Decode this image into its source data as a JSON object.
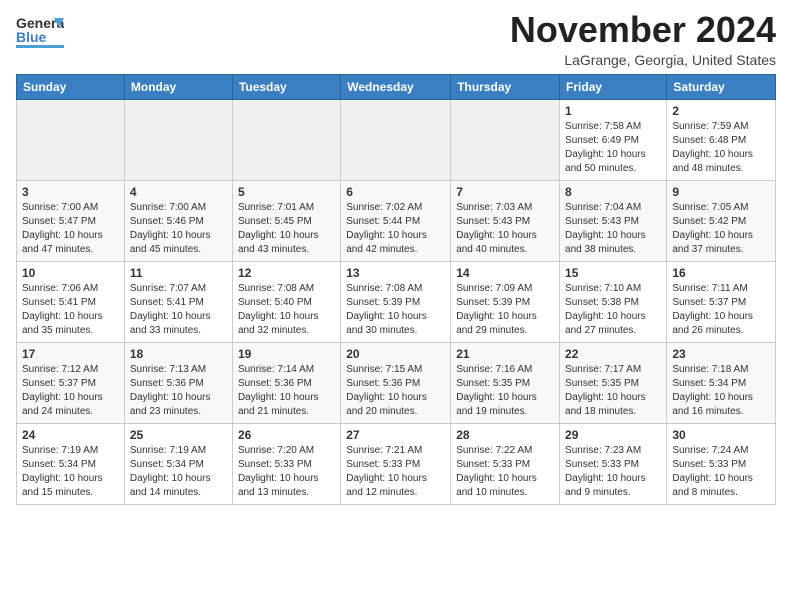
{
  "header": {
    "logo_line1": "General",
    "logo_line2": "Blue",
    "month": "November 2024",
    "location": "LaGrange, Georgia, United States"
  },
  "weekdays": [
    "Sunday",
    "Monday",
    "Tuesday",
    "Wednesday",
    "Thursday",
    "Friday",
    "Saturday"
  ],
  "weeks": [
    [
      {
        "day": "",
        "info": ""
      },
      {
        "day": "",
        "info": ""
      },
      {
        "day": "",
        "info": ""
      },
      {
        "day": "",
        "info": ""
      },
      {
        "day": "",
        "info": ""
      },
      {
        "day": "1",
        "info": "Sunrise: 7:58 AM\nSunset: 6:49 PM\nDaylight: 10 hours\nand 50 minutes."
      },
      {
        "day": "2",
        "info": "Sunrise: 7:59 AM\nSunset: 6:48 PM\nDaylight: 10 hours\nand 48 minutes."
      }
    ],
    [
      {
        "day": "3",
        "info": "Sunrise: 7:00 AM\nSunset: 5:47 PM\nDaylight: 10 hours\nand 47 minutes."
      },
      {
        "day": "4",
        "info": "Sunrise: 7:00 AM\nSunset: 5:46 PM\nDaylight: 10 hours\nand 45 minutes."
      },
      {
        "day": "5",
        "info": "Sunrise: 7:01 AM\nSunset: 5:45 PM\nDaylight: 10 hours\nand 43 minutes."
      },
      {
        "day": "6",
        "info": "Sunrise: 7:02 AM\nSunset: 5:44 PM\nDaylight: 10 hours\nand 42 minutes."
      },
      {
        "day": "7",
        "info": "Sunrise: 7:03 AM\nSunset: 5:43 PM\nDaylight: 10 hours\nand 40 minutes."
      },
      {
        "day": "8",
        "info": "Sunrise: 7:04 AM\nSunset: 5:43 PM\nDaylight: 10 hours\nand 38 minutes."
      },
      {
        "day": "9",
        "info": "Sunrise: 7:05 AM\nSunset: 5:42 PM\nDaylight: 10 hours\nand 37 minutes."
      }
    ],
    [
      {
        "day": "10",
        "info": "Sunrise: 7:06 AM\nSunset: 5:41 PM\nDaylight: 10 hours\nand 35 minutes."
      },
      {
        "day": "11",
        "info": "Sunrise: 7:07 AM\nSunset: 5:41 PM\nDaylight: 10 hours\nand 33 minutes."
      },
      {
        "day": "12",
        "info": "Sunrise: 7:08 AM\nSunset: 5:40 PM\nDaylight: 10 hours\nand 32 minutes."
      },
      {
        "day": "13",
        "info": "Sunrise: 7:08 AM\nSunset: 5:39 PM\nDaylight: 10 hours\nand 30 minutes."
      },
      {
        "day": "14",
        "info": "Sunrise: 7:09 AM\nSunset: 5:39 PM\nDaylight: 10 hours\nand 29 minutes."
      },
      {
        "day": "15",
        "info": "Sunrise: 7:10 AM\nSunset: 5:38 PM\nDaylight: 10 hours\nand 27 minutes."
      },
      {
        "day": "16",
        "info": "Sunrise: 7:11 AM\nSunset: 5:37 PM\nDaylight: 10 hours\nand 26 minutes."
      }
    ],
    [
      {
        "day": "17",
        "info": "Sunrise: 7:12 AM\nSunset: 5:37 PM\nDaylight: 10 hours\nand 24 minutes."
      },
      {
        "day": "18",
        "info": "Sunrise: 7:13 AM\nSunset: 5:36 PM\nDaylight: 10 hours\nand 23 minutes."
      },
      {
        "day": "19",
        "info": "Sunrise: 7:14 AM\nSunset: 5:36 PM\nDaylight: 10 hours\nand 21 minutes."
      },
      {
        "day": "20",
        "info": "Sunrise: 7:15 AM\nSunset: 5:36 PM\nDaylight: 10 hours\nand 20 minutes."
      },
      {
        "day": "21",
        "info": "Sunrise: 7:16 AM\nSunset: 5:35 PM\nDaylight: 10 hours\nand 19 minutes."
      },
      {
        "day": "22",
        "info": "Sunrise: 7:17 AM\nSunset: 5:35 PM\nDaylight: 10 hours\nand 18 minutes."
      },
      {
        "day": "23",
        "info": "Sunrise: 7:18 AM\nSunset: 5:34 PM\nDaylight: 10 hours\nand 16 minutes."
      }
    ],
    [
      {
        "day": "24",
        "info": "Sunrise: 7:19 AM\nSunset: 5:34 PM\nDaylight: 10 hours\nand 15 minutes."
      },
      {
        "day": "25",
        "info": "Sunrise: 7:19 AM\nSunset: 5:34 PM\nDaylight: 10 hours\nand 14 minutes."
      },
      {
        "day": "26",
        "info": "Sunrise: 7:20 AM\nSunset: 5:33 PM\nDaylight: 10 hours\nand 13 minutes."
      },
      {
        "day": "27",
        "info": "Sunrise: 7:21 AM\nSunset: 5:33 PM\nDaylight: 10 hours\nand 12 minutes."
      },
      {
        "day": "28",
        "info": "Sunrise: 7:22 AM\nSunset: 5:33 PM\nDaylight: 10 hours\nand 10 minutes."
      },
      {
        "day": "29",
        "info": "Sunrise: 7:23 AM\nSunset: 5:33 PM\nDaylight: 10 hours\nand 9 minutes."
      },
      {
        "day": "30",
        "info": "Sunrise: 7:24 AM\nSunset: 5:33 PM\nDaylight: 10 hours\nand 8 minutes."
      }
    ]
  ]
}
